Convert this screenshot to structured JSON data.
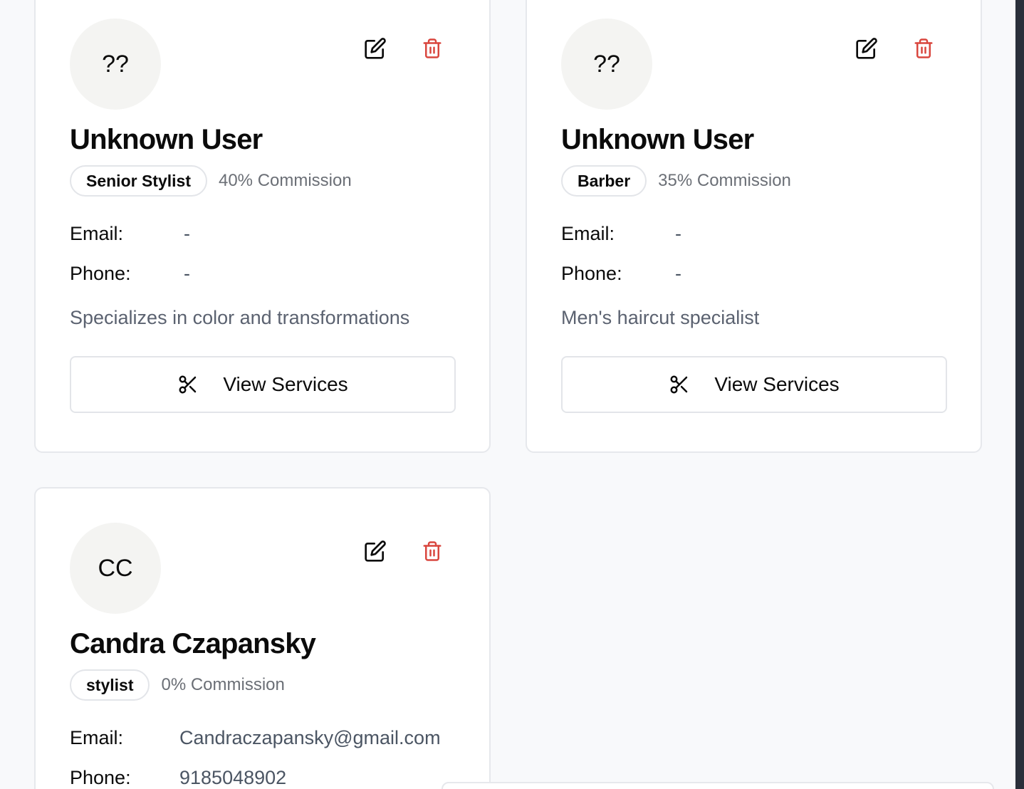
{
  "staff": [
    {
      "initials": "??",
      "name": "Unknown User",
      "role": "Senior Stylist",
      "commission": "40% Commission",
      "email_label": "Email:",
      "email": "-",
      "phone_label": "Phone:",
      "phone": "-",
      "description": "Specializes in color and transformations",
      "services_label": "View Services"
    },
    {
      "initials": "??",
      "name": "Unknown User",
      "role": "Barber",
      "commission": "35% Commission",
      "email_label": "Email:",
      "email": "-",
      "phone_label": "Phone:",
      "phone": "-",
      "description": "Men's haircut specialist",
      "services_label": "View Services"
    },
    {
      "initials": "CC",
      "name": "Candra Czapansky",
      "role": "stylist",
      "commission": "0% Commission",
      "email_label": "Email:",
      "email": "Candraczapansky@gmail.com",
      "phone_label": "Phone:",
      "phone": "9185048902"
    }
  ],
  "icons": {
    "edit": "edit-icon",
    "delete": "trash-icon",
    "services": "scissors-icon"
  },
  "colors": {
    "delete": "#d9463e",
    "accent_text": "#0b0b0b",
    "muted_text": "#6b6f76"
  }
}
